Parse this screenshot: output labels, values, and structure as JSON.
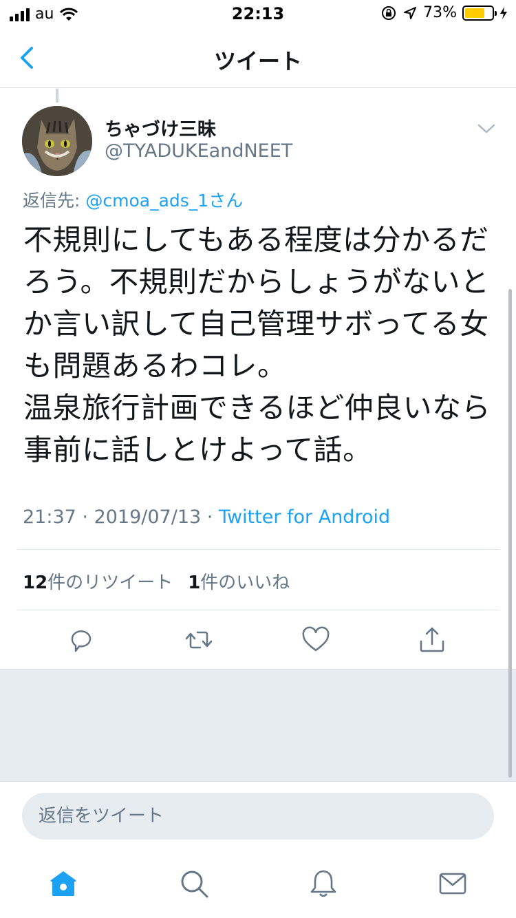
{
  "status_bar": {
    "carrier": "au",
    "time": "22:13",
    "battery_percent": "73%",
    "battery_level": 0.73,
    "battery_color": "#ffcc00"
  },
  "header": {
    "back_icon": "chevron-left-icon",
    "title": "ツイート"
  },
  "tweet": {
    "display_name": "ちゃづけ三昧",
    "handle": "@TYADUKEandNEET",
    "reply_prefix": "返信先: ",
    "reply_mention": "@cmoa_ads_1さん",
    "text": "不規則にしてもある程度は分かるだろう。不規則だからしょうがないとか言い訳して自己管理サボってる女も問題あるわコレ。\n温泉旅行計画できるほど仲良いなら事前に話しとけよって話。",
    "time": "21:37",
    "date": "2019/07/13",
    "separator": " · ",
    "source": "Twitter for Android",
    "retweet_count": "12",
    "retweet_label": "件のリツイート",
    "like_count": "1",
    "like_label": "件のいいね"
  },
  "actions": [
    "reply-icon",
    "retweet-icon",
    "like-icon",
    "share-icon"
  ],
  "reply_box": {
    "placeholder": "返信をツイート"
  },
  "tabbar": [
    "home-icon",
    "search-icon",
    "notifications-icon",
    "messages-icon"
  ],
  "colors": {
    "accent": "#1da1f2",
    "secondary_text": "#657786",
    "primary_text": "#14171a",
    "background_gray": "#e6ecf0"
  }
}
